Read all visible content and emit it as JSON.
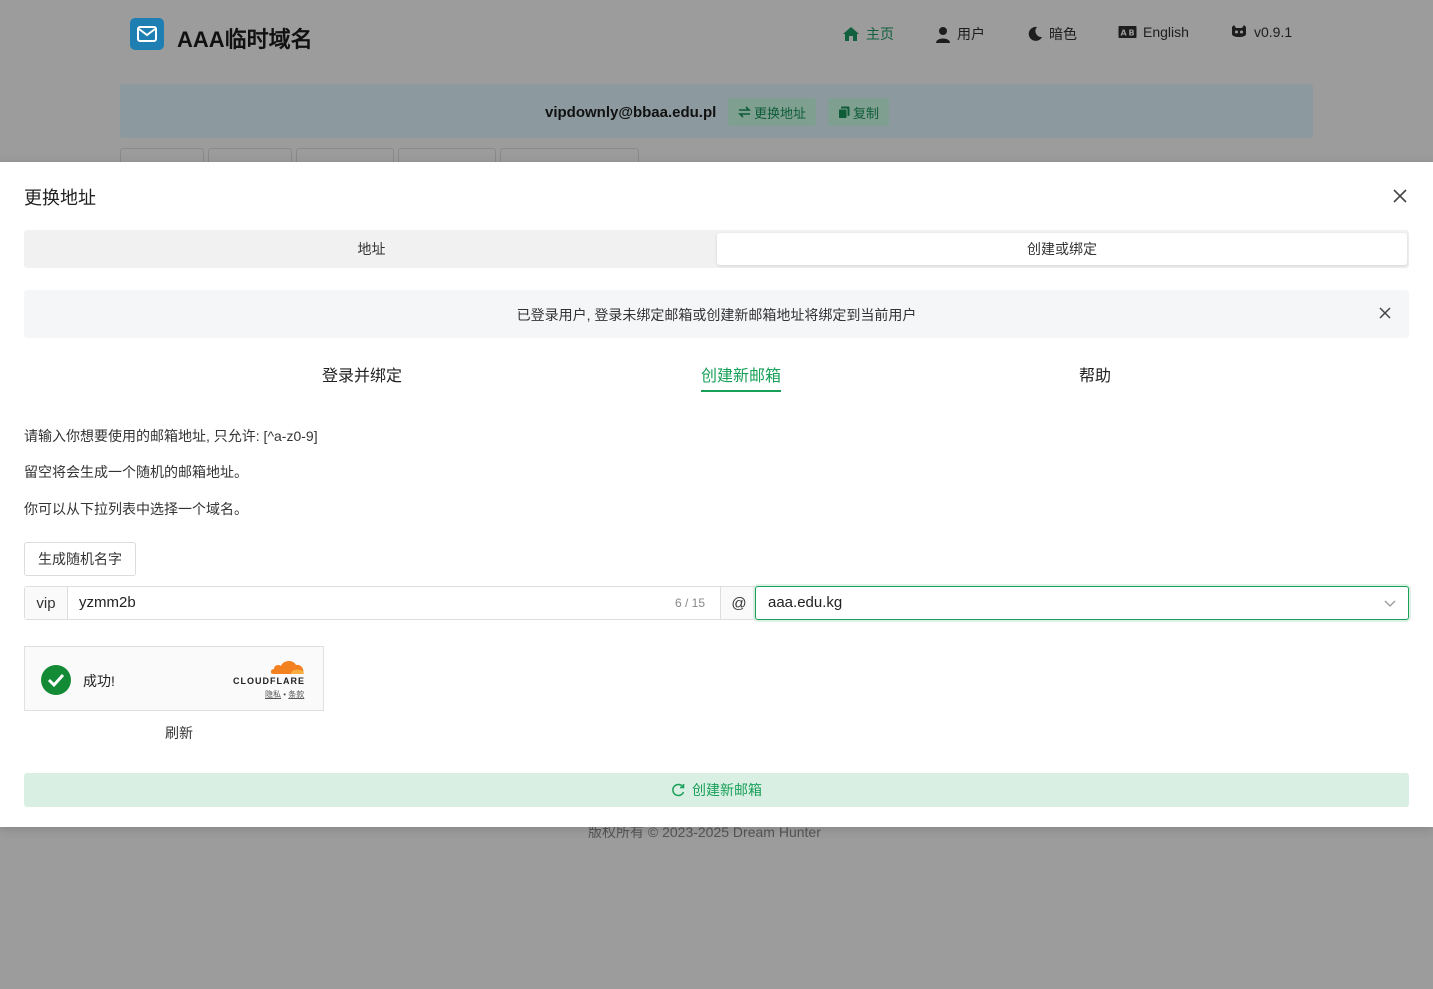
{
  "header": {
    "site_title": "AAA临时域名",
    "nav": {
      "home": "主页",
      "user": "用户",
      "dark": "暗色",
      "language": "English",
      "version": "v0.9.1"
    }
  },
  "address_bar": {
    "address": "vipdownly@bbaa.edu.pl",
    "change_label": "更换地址",
    "copy_label": "复制"
  },
  "footer": {
    "text": "版权所有 © 2023-2025   Dream Hunter"
  },
  "modal": {
    "title": "更换地址",
    "segments": [
      "地址",
      "创建或绑定"
    ],
    "active_segment": "创建或绑定",
    "alert": "已登录用户, 登录未绑定邮箱或创建新邮箱地址将绑定到当前用户",
    "tabs": [
      "登录并绑定",
      "创建新邮箱",
      "帮助"
    ],
    "active_tab": "创建新邮箱",
    "instructions": [
      "请输入你想要使用的邮箱地址, 只允许: [^a-z0-9]",
      "留空将会生成一个随机的邮箱地址。",
      "你可以从下拉列表中选择一个域名。"
    ],
    "generate_button": "生成随机名字",
    "prefix": "vip",
    "name_value": "yzmm2b",
    "counter": "6 / 15",
    "at": "@",
    "domain_selected": "aaa.edu.kg",
    "turnstile": {
      "status": "成功!",
      "brand": "CLOUDFLARE",
      "privacy": "隐私",
      "separator": "•",
      "terms": "条款"
    },
    "refresh_label": "刷新",
    "create_button": "创建新邮箱"
  },
  "colors": {
    "accent": "#18a058",
    "logo": "#1f7fb3",
    "overlay": "#9c9c9c",
    "cloudflare": "#f48120"
  }
}
